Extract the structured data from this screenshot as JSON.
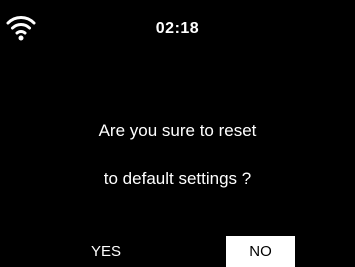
{
  "status_bar": {
    "time": "02:18",
    "wifi_icon": "wifi-icon"
  },
  "dialog": {
    "message_line1": "Are you sure to reset",
    "message_line2": "to default settings ?",
    "yes_label": "YES",
    "no_label": "NO",
    "selected": "NO"
  },
  "colors": {
    "background": "#000000",
    "text": "#ffffff",
    "selected_bg": "#ffffff",
    "selected_text": "#000000"
  }
}
